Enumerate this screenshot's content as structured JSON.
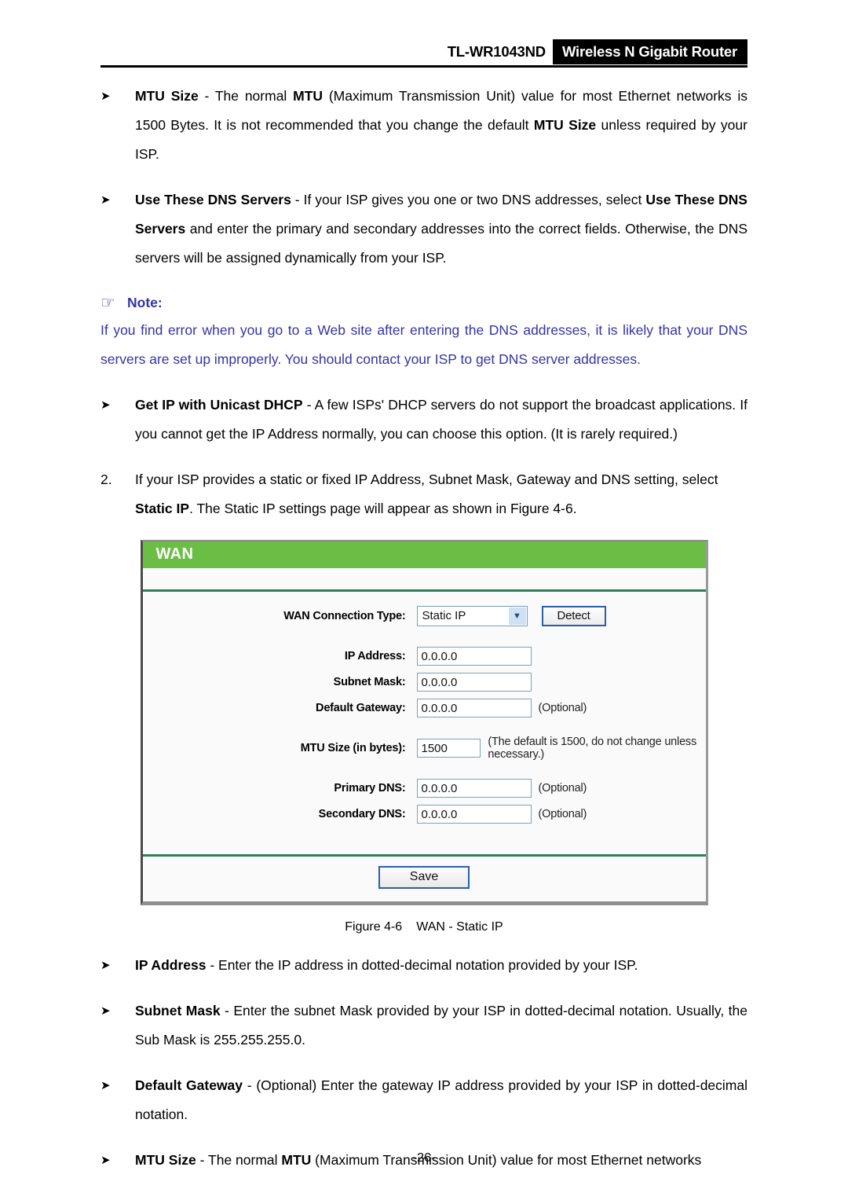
{
  "header": {
    "model": "TL-WR1043ND",
    "product": "Wireless N Gigabit Router"
  },
  "bullets_top": [
    {
      "marker": "➤",
      "segments": [
        {
          "text": "MTU Size",
          "bold": true
        },
        {
          "text": " - The normal ",
          "bold": false
        },
        {
          "text": "MTU",
          "bold": true
        },
        {
          "text": " (Maximum Transmission Unit) value for most Ethernet networks is 1500 Bytes. It is not recommended that you change the default ",
          "bold": false
        },
        {
          "text": "MTU Size",
          "bold": true
        },
        {
          "text": " unless required by your ISP.",
          "bold": false
        }
      ]
    },
    {
      "marker": "➤",
      "segments": [
        {
          "text": "Use These DNS Servers",
          "bold": true
        },
        {
          "text": " - If your ISP gives you one or two DNS addresses, select ",
          "bold": false
        },
        {
          "text": "Use These DNS Servers",
          "bold": true
        },
        {
          "text": " and enter the primary and secondary addresses into the correct fields. Otherwise, the DNS servers will be assigned dynamically from your ISP.",
          "bold": false
        }
      ]
    }
  ],
  "note": {
    "icon": "pointing-hand-icon",
    "icon_glyph": "☞",
    "title": "Note:",
    "body": "If you find error when you go to a Web site after entering the DNS addresses, it is likely that your DNS servers are set up improperly. You should contact your ISP to get DNS server addresses.",
    "color": "#3333a6"
  },
  "bullet_unicast": {
    "marker": "➤",
    "segments": [
      {
        "text": "Get IP with Unicast DHCP",
        "bold": true
      },
      {
        "text": " - A few ISPs' DHCP servers do not support the broadcast applications. If you cannot get the IP Address normally, you can choose this option. (It is rarely required.)",
        "bold": false
      }
    ]
  },
  "numbered_item": {
    "marker": "2.",
    "segments": [
      {
        "text": "If your ISP provides a static or fixed IP Address, Subnet Mask, Gateway and DNS setting, select ",
        "bold": false
      },
      {
        "text": "Static IP",
        "bold": true
      },
      {
        "text": ". The Static IP settings page will appear as shown in Figure 4-6.",
        "bold": false
      }
    ]
  },
  "router_ui": {
    "panel_title": "WAN",
    "accent_color": "#6bbe45",
    "rule_color": "#2f7d5d",
    "connection_type": {
      "label": "WAN Connection Type:",
      "selected": "Static IP",
      "arrow_icon": "chevron-down-icon",
      "arrow_glyph": "▼",
      "detect_button": "Detect"
    },
    "fields": [
      {
        "label": "IP Address:",
        "value": "0.0.0.0",
        "hint": ""
      },
      {
        "label": "Subnet Mask:",
        "value": "0.0.0.0",
        "hint": ""
      },
      {
        "label": "Default Gateway:",
        "value": "0.0.0.0",
        "hint": "(Optional)"
      }
    ],
    "mtu": {
      "label": "MTU Size (in bytes):",
      "value": "1500",
      "hint": "(The default is 1500, do not change unless necessary.)"
    },
    "dns_fields": [
      {
        "label": "Primary DNS:",
        "value": "0.0.0.0",
        "hint": "(Optional)"
      },
      {
        "label": "Secondary DNS:",
        "value": "0.0.0.0",
        "hint": "(Optional)"
      }
    ],
    "save_button": "Save"
  },
  "figure_caption": {
    "number": "Figure 4-6",
    "title": "WAN - Static IP"
  },
  "bullets_bottom": [
    {
      "marker": "➤",
      "segments": [
        {
          "text": "IP Address",
          "bold": true
        },
        {
          "text": " - Enter the IP address in dotted-decimal notation provided by your ISP.",
          "bold": false
        }
      ]
    },
    {
      "marker": "➤",
      "segments": [
        {
          "text": "Subnet Mask",
          "bold": true
        },
        {
          "text": " - Enter the subnet Mask provided by your ISP in dotted-decimal notation. Usually, the Sub Mask is 255.255.255.0.",
          "bold": false
        }
      ]
    },
    {
      "marker": "➤",
      "segments": [
        {
          "text": "Default Gateway",
          "bold": true
        },
        {
          "text": " - (Optional) Enter the gateway IP address provided by your ISP in dotted-decimal notation.",
          "bold": false
        }
      ]
    },
    {
      "marker": "➤",
      "segments": [
        {
          "text": "MTU Size",
          "bold": true
        },
        {
          "text": " - The normal ",
          "bold": false
        },
        {
          "text": "MTU",
          "bold": true
        },
        {
          "text": " (Maximum Transmission Unit) value for most Ethernet networks",
          "bold": false
        }
      ]
    }
  ],
  "footer": {
    "page_number": "-26-"
  }
}
